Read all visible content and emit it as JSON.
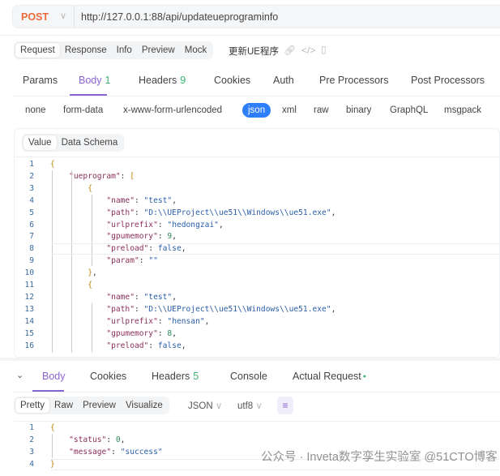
{
  "request": {
    "method": "POST",
    "url": "http://127.0.0.1:88/api/updateueprograminfo"
  },
  "view_tabs": [
    "Request",
    "Response",
    "Info",
    "Preview",
    "Mock"
  ],
  "api_name": "更新UE程序",
  "icons": [
    "link-icon",
    "code-icon",
    "panel-icon"
  ],
  "param_tabs": [
    {
      "label": "Params"
    },
    {
      "label": "Body",
      "count": "1"
    },
    {
      "label": "Headers",
      "count": "9"
    },
    {
      "label": "Cookies"
    },
    {
      "label": "Auth"
    },
    {
      "label": "Pre Processors"
    },
    {
      "label": "Post Processors"
    }
  ],
  "body_types": [
    "none",
    "form-data",
    "x-www-form-urlencoded",
    "json",
    "xml",
    "raw",
    "binary",
    "GraphQL",
    "msgpack"
  ],
  "body_type_selected": "json",
  "editor_tabs": [
    "Value",
    "Data Schema"
  ],
  "request_body_lines": [
    "{",
    "    \"ueprogram\": [",
    "        {",
    "            \"name\": \"test\",",
    "            \"path\": \"D:\\\\UEProject\\\\ue51\\\\Windows\\\\ue51.exe\",",
    "            \"urlprefix\": \"hedongzai\",",
    "            \"gpumemory\": 9,",
    "            \"preload\": false,",
    "            \"param\": \"\"",
    "        },",
    "        {",
    "            \"name\": \"test\",",
    "            \"path\": \"D:\\\\UEProject\\\\ue51\\\\Windows\\\\ue51.exe\",",
    "            \"urlprefix\": \"hensan\",",
    "            \"gpumemory\": 8,",
    "            \"preload\": false,"
  ],
  "response_tabs": [
    {
      "label": "Body"
    },
    {
      "label": "Cookies"
    },
    {
      "label": "Headers",
      "count": "5"
    },
    {
      "label": "Console"
    },
    {
      "label": "Actual Request"
    }
  ],
  "response_view": [
    "Pretty",
    "Raw",
    "Preview",
    "Visualize"
  ],
  "format_select": "JSON",
  "encoding_select": "utf8",
  "response_body_lines": [
    "{",
    "    \"status\": 0,",
    "    \"message\": \"success\"",
    "}"
  ],
  "watermark": "公众号 · Inveta数字孪生实验室  @51CTO博客",
  "colors": {
    "accent": "#8a63d2",
    "method": "#ec6a3a",
    "json_pill": "#2d7ff9",
    "count": "#3cb371"
  }
}
